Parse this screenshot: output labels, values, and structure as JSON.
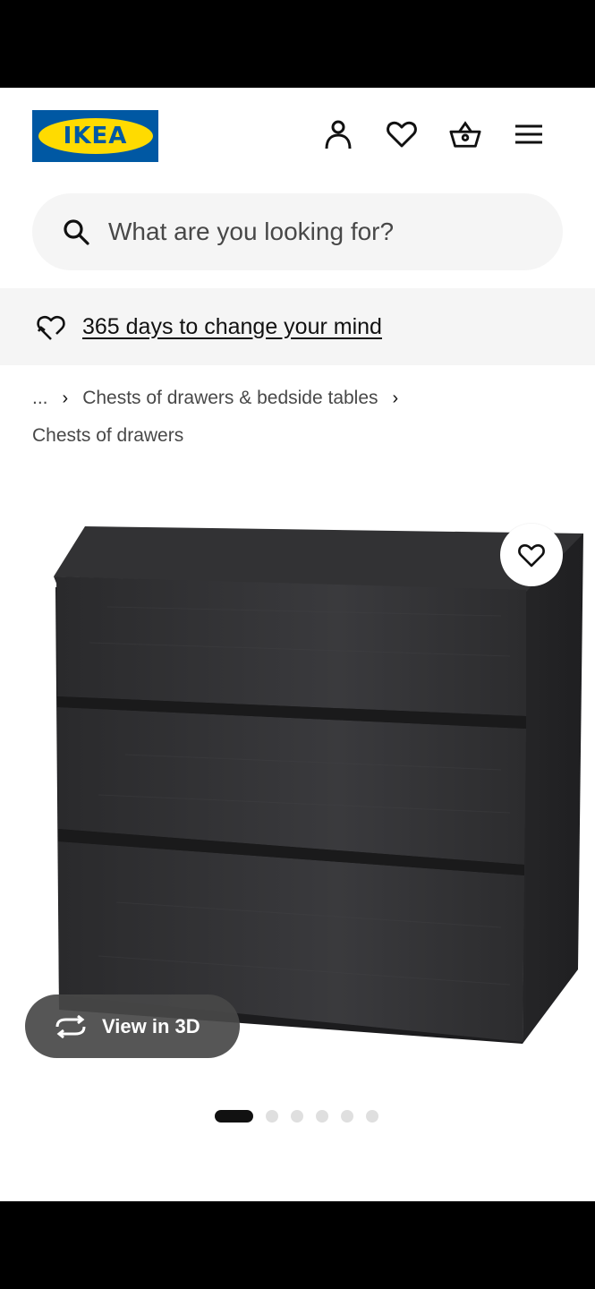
{
  "header": {
    "logo_text": "IKEA",
    "icons": [
      "person-icon",
      "heart-icon",
      "basket-icon",
      "hamburger-menu-icon"
    ]
  },
  "search": {
    "placeholder": "What are you looking for?"
  },
  "banner": {
    "link_text": "365 days to change your mind"
  },
  "breadcrumb": {
    "ellipsis": "...",
    "item_1": "Chests of drawers & bedside tables",
    "item_2": "Chests of drawers"
  },
  "product": {
    "view_3d_label": "View in 3D",
    "image_count": 6,
    "active_image_index": 0
  },
  "colors": {
    "ikea_blue": "#0058a3",
    "ikea_yellow": "#ffdb00",
    "search_bg": "#f5f5f5",
    "dresser": "#2b2b2d"
  }
}
